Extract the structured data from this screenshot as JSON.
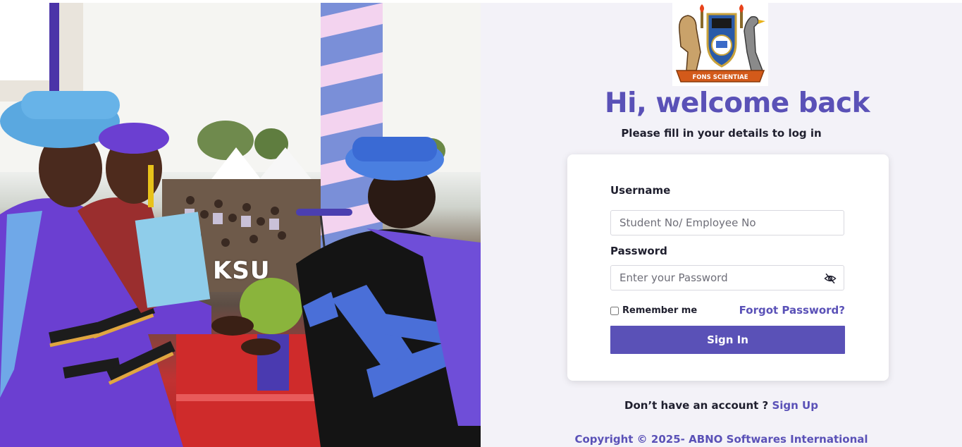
{
  "photo": {
    "overlay_text": "KSU"
  },
  "crest": {
    "motto": "FONS SCIENTIAE"
  },
  "login": {
    "heading": "Hi, welcome back",
    "subheading": "Please fill in your details to log in",
    "username_label": "Username",
    "username_placeholder": "Student No/ Employee No",
    "password_label": "Password",
    "password_placeholder": "Enter your Password",
    "remember_label": "Remember me",
    "forgot_label": "Forgot Password?",
    "signin_label": "Sign In"
  },
  "footer": {
    "no_account_text": "Don’t have an account ?",
    "signup_label": "Sign Up",
    "copyright": "Copyright © 2025- ABNO Softwares International"
  },
  "colors": {
    "accent": "#5a51b7",
    "panel_bg": "#f3f2f8",
    "text_dark": "#1f1f2e"
  },
  "icons": {
    "password_toggle": "eye-slash-icon"
  }
}
